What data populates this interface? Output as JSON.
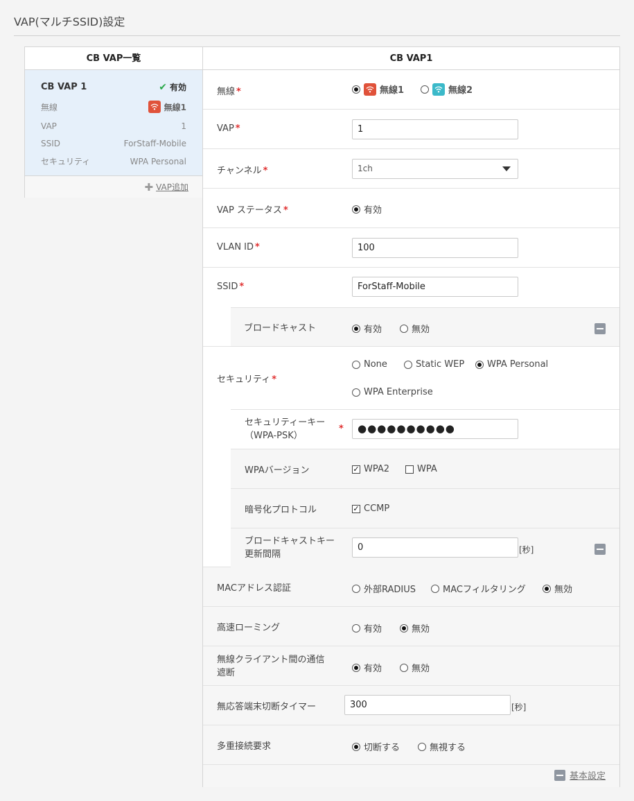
{
  "page_title": "VAP(マルチSSID)設定",
  "left_panel": {
    "header": "CB VAP一覧",
    "card": {
      "name": "CB VAP 1",
      "status": "有効",
      "rows": [
        {
          "label": "無線",
          "value": "無線1"
        },
        {
          "label": "VAP",
          "value": "1"
        },
        {
          "label": "SSID",
          "value": "ForStaff-Mobile"
        },
        {
          "label": "セキュリティ",
          "value": "WPA Personal"
        }
      ]
    },
    "add_label": "VAP追加"
  },
  "right_panel": {
    "header": "CB VAP1",
    "radio_label": "無線",
    "radio_options": [
      "無線1",
      "無線2"
    ],
    "vap_label": "VAP",
    "vap_value": "1",
    "channel_label": "チャンネル",
    "channel_value": "1ch",
    "vap_status_label": "VAP ステータス",
    "vap_status_option": "有効",
    "vlan_label": "VLAN ID",
    "vlan_value": "100",
    "ssid_label": "SSID",
    "ssid_value": "ForStaff-Mobile",
    "broadcast_label": "ブロードキャスト",
    "broadcast_options": [
      "有効",
      "無効"
    ],
    "security_label": "セキュリティ",
    "security_options": [
      "None",
      "Static WEP",
      "WPA Personal",
      "WPA Enterprise"
    ],
    "seckey_label_1": "セキュリティーキー",
    "seckey_label_2": "（WPA-PSK）",
    "seckey_value": "●●●●●●●●●●",
    "wpa_version_label": "WPAバージョン",
    "wpa_version_options": [
      "WPA2",
      "WPA"
    ],
    "cipher_label": "暗号化プロトコル",
    "cipher_option": "CCMP",
    "bcast_key_label_1": "ブロードキャストキー",
    "bcast_key_label_2": "更新間隔",
    "bcast_key_value": "0",
    "unit_sec": "[秒]",
    "mac_auth_label": "MACアドレス認証",
    "mac_auth_options": [
      "外部RADIUS",
      "MACフィルタリング",
      "無効"
    ],
    "fast_roam_label": "高速ローミング",
    "fast_roam_options": [
      "有効",
      "無効"
    ],
    "client_block_label_1": "無線クライアント間の通信",
    "client_block_label_2": "遮断",
    "client_block_options": [
      "有効",
      "無効"
    ],
    "idle_timer_label": "無応答端末切断タイマー",
    "idle_timer_value": "300",
    "multi_conn_label": "多重接続要求",
    "multi_conn_options": [
      "切断する",
      "無視する"
    ],
    "basic_settings_link": "基本設定"
  },
  "colors": {
    "radio1_icon": "#e0523a",
    "radio2_icon": "#3bb9c9",
    "selected_card": "#e6f0fa",
    "required_mark": "#e03030",
    "check": "#2aa84a"
  }
}
